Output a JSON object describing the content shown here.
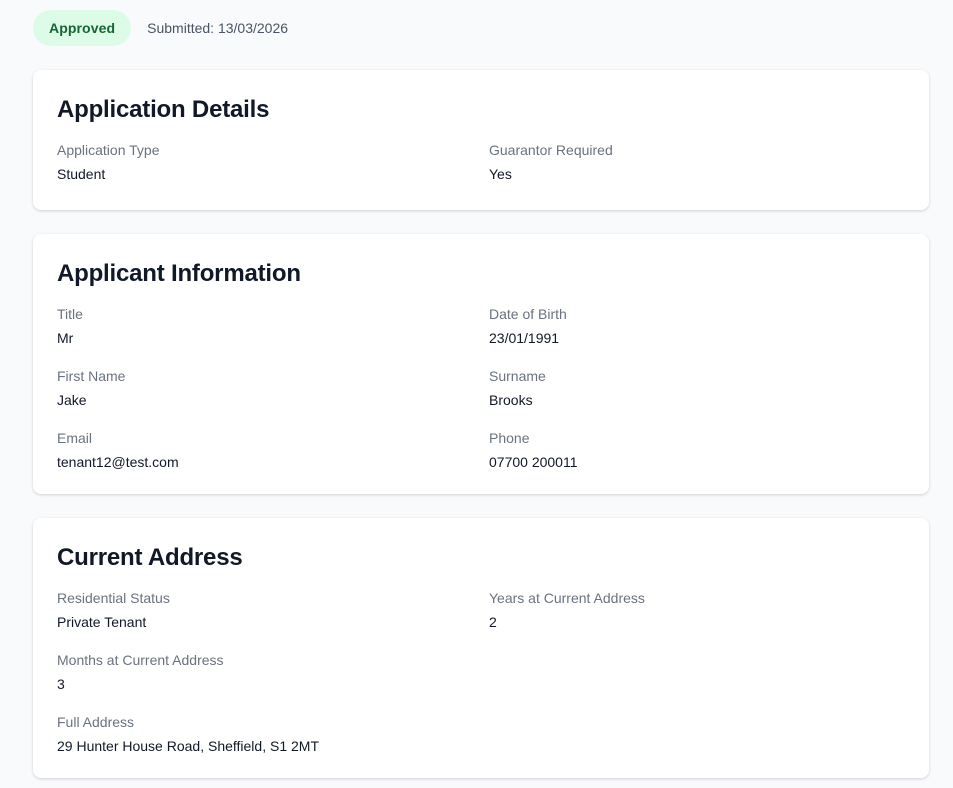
{
  "status": {
    "label": "Approved",
    "bg_color": "#dcfce7",
    "text_color": "#166534"
  },
  "submitted_text": "Submitted: 13/03/2026",
  "sections": {
    "application_details": {
      "title": "Application Details",
      "fields": [
        {
          "label": "Application Type",
          "value": "Student"
        },
        {
          "label": "Guarantor Required",
          "value": "Yes"
        }
      ]
    },
    "applicant_information": {
      "title": "Applicant Information",
      "fields": [
        {
          "label": "Title",
          "value": "Mr"
        },
        {
          "label": "Date of Birth",
          "value": "23/01/1991"
        },
        {
          "label": "First Name",
          "value": "Jake"
        },
        {
          "label": "Surname",
          "value": "Brooks"
        },
        {
          "label": "Email",
          "value": "tenant12@test.com"
        },
        {
          "label": "Phone",
          "value": "07700 200011"
        }
      ]
    },
    "current_address": {
      "title": "Current Address",
      "fields": [
        {
          "label": "Residential Status",
          "value": "Private Tenant"
        },
        {
          "label": "Years at Current Address",
          "value": "2"
        },
        {
          "label": "Months at Current Address",
          "value": "3"
        },
        {
          "label": "Full Address",
          "value": "29 Hunter House Road, Sheffield, S1 2MT"
        }
      ]
    }
  }
}
